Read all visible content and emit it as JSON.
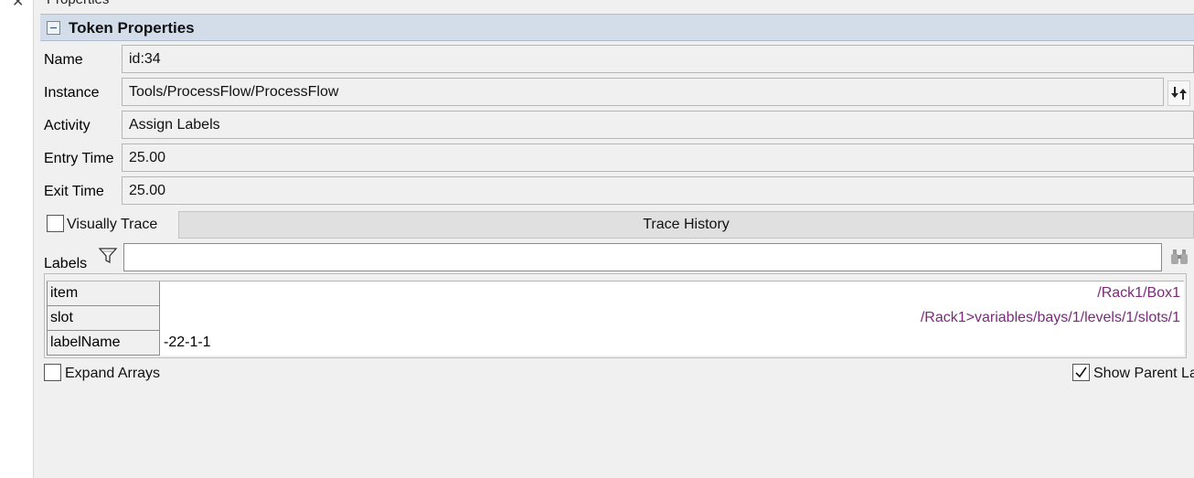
{
  "panel": {
    "caption": "Properties"
  },
  "section": {
    "title": "Token Properties"
  },
  "fields": {
    "name": {
      "label": "Name",
      "value": "id:34"
    },
    "instance": {
      "label": "Instance",
      "value": "Tools/ProcessFlow/ProcessFlow"
    },
    "activity": {
      "label": "Activity",
      "value": "Assign Labels"
    },
    "entry_time": {
      "label": "Entry Time",
      "value": "25.00"
    },
    "exit_time": {
      "label": "Exit Time",
      "value": "25.00"
    }
  },
  "trace": {
    "visually_trace_label": "Visually Trace",
    "visually_trace_checked": false,
    "history_button": "Trace History"
  },
  "labels": {
    "title": "Labels",
    "search_value": "",
    "rows": [
      {
        "key": "item",
        "value": "/Rack1/Box1",
        "is_link": true
      },
      {
        "key": "slot",
        "value": "/Rack1>variables/bays/1/levels/1/slots/1",
        "is_link": true
      },
      {
        "key": "labelName",
        "value": "-22-1-1",
        "is_link": false
      }
    ]
  },
  "options": {
    "expand_arrays_label": "Expand Arrays",
    "expand_arrays_checked": false,
    "show_parent_label": "Show Parent La",
    "show_parent_checked": true
  },
  "icons": {
    "close": "close-icon",
    "filter": "filter-icon",
    "swap": "swap-icon",
    "find": "binoculars-icon"
  },
  "colors": {
    "header_bg": "#d3dde9",
    "link": "#7a2a7a",
    "panel_bg": "#f0f0f0"
  }
}
